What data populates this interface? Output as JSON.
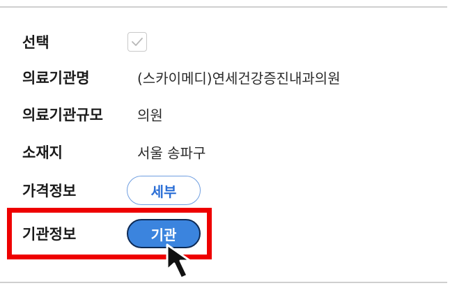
{
  "form": {
    "select_label": "선택",
    "select_checked": true,
    "institution_name_label": "의료기관명",
    "institution_name_value": "(스카이메디)연세건강증진내과의원",
    "institution_size_label": "의료기관규모",
    "institution_size_value": "의원",
    "location_label": "소재지",
    "location_value": "서울 송파구",
    "price_info_label": "가격정보",
    "price_info_button": "세부",
    "institution_info_label": "기관정보",
    "institution_info_button": "기관"
  },
  "colors": {
    "highlight_border": "#ee0000",
    "outline_button_border": "#6f9ee0",
    "outline_button_text": "#2c6fd6",
    "filled_button_bg": "#3b84de",
    "filled_button_border": "#0d2a55"
  },
  "icons": {
    "checkbox": "check-icon",
    "pointer": "mouse-pointer-icon"
  }
}
